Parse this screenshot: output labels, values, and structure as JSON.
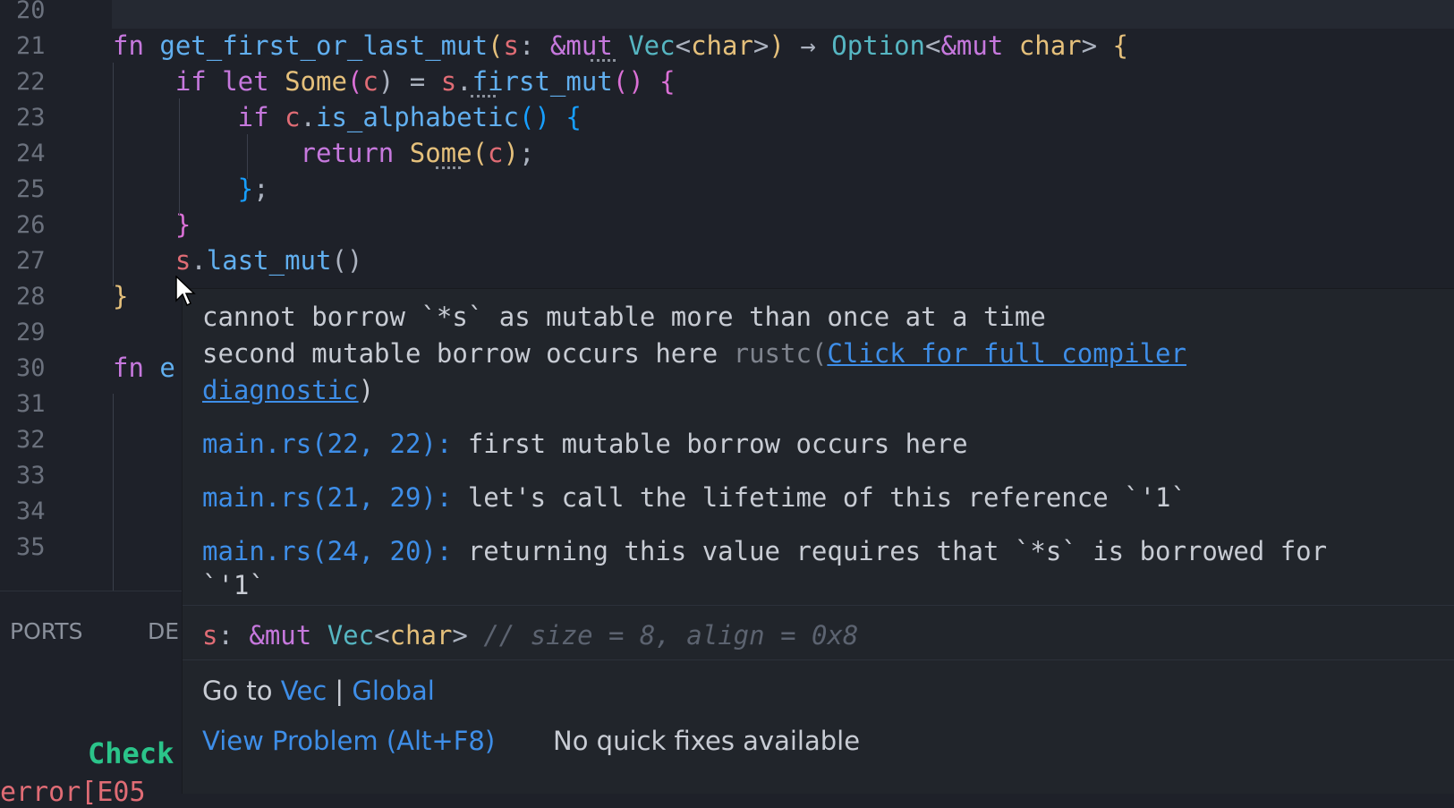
{
  "editor": {
    "lines": [
      {
        "num": "20",
        "tokens": []
      },
      {
        "num": "21",
        "tokens": [
          {
            "t": "fn ",
            "c": "k"
          },
          {
            "t": "get_first_or_last_mut",
            "c": "f"
          },
          {
            "t": "(",
            "c": "b1"
          },
          {
            "t": "s",
            "c": "v"
          },
          {
            "t": ": ",
            "c": "p"
          },
          {
            "t": "&mut ",
            "c": "k"
          },
          {
            "t": "Vec",
            "c": "t"
          },
          {
            "t": "<",
            "c": "p"
          },
          {
            "t": "char",
            "c": "y"
          },
          {
            "t": ">",
            "c": "p"
          },
          {
            "t": ") ",
            "c": "b1"
          },
          {
            "t": "→ ",
            "c": "p"
          },
          {
            "t": "Option",
            "c": "t"
          },
          {
            "t": "<",
            "c": "p"
          },
          {
            "t": "&mut ",
            "c": "k"
          },
          {
            "t": "char",
            "c": "y"
          },
          {
            "t": "> ",
            "c": "p"
          },
          {
            "t": "{",
            "c": "b1"
          }
        ]
      },
      {
        "num": "22",
        "tokens": [
          {
            "t": "    if let ",
            "c": "k"
          },
          {
            "t": "Some",
            "c": "y"
          },
          {
            "t": "(",
            "c": "b2"
          },
          {
            "t": "c",
            "c": "v"
          },
          {
            "t": ") = ",
            "c": "p"
          },
          {
            "t": "s",
            "c": "v"
          },
          {
            "t": ".",
            "c": "p"
          },
          {
            "t": "first_mut",
            "c": "f"
          },
          {
            "t": "() ",
            "c": "b2"
          },
          {
            "t": "{",
            "c": "b2"
          }
        ]
      },
      {
        "num": "23",
        "tokens": [
          {
            "t": "        if ",
            "c": "k"
          },
          {
            "t": "c",
            "c": "v"
          },
          {
            "t": ".",
            "c": "p"
          },
          {
            "t": "is_alphabetic",
            "c": "f"
          },
          {
            "t": "() {",
            "c": "b3"
          }
        ]
      },
      {
        "num": "24",
        "tokens": [
          {
            "t": "            return ",
            "c": "k"
          },
          {
            "t": "Some",
            "c": "y"
          },
          {
            "t": "(",
            "c": "b1"
          },
          {
            "t": "c",
            "c": "v"
          },
          {
            "t": ")",
            "c": "b1"
          },
          {
            "t": ";",
            "c": "p"
          }
        ]
      },
      {
        "num": "25",
        "tokens": [
          {
            "t": "        }",
            "c": "b3"
          },
          {
            "t": ";",
            "c": "p"
          }
        ]
      },
      {
        "num": "26",
        "tokens": [
          {
            "t": "    }",
            "c": "b2"
          }
        ]
      },
      {
        "num": "27",
        "tokens": [
          {
            "t": "    s",
            "c": "v"
          },
          {
            "t": ".",
            "c": "p"
          },
          {
            "t": "last_mut",
            "c": "f"
          },
          {
            "t": "()",
            "c": "p"
          }
        ]
      },
      {
        "num": "28",
        "tokens": [
          {
            "t": "}",
            "c": "b1"
          }
        ]
      },
      {
        "num": "29",
        "tokens": []
      },
      {
        "num": "30",
        "tokens": [
          {
            "t": "fn ",
            "c": "k"
          },
          {
            "t": "e",
            "c": "f"
          }
        ]
      },
      {
        "num": "31",
        "tokens": []
      },
      {
        "num": "32",
        "tokens": []
      },
      {
        "num": "33",
        "tokens": []
      },
      {
        "num": "34",
        "tokens": []
      },
      {
        "num": "35",
        "tokens": []
      }
    ]
  },
  "panel": {
    "tabs": [
      "PORTS",
      "DE"
    ],
    "terminal_line1": "Check",
    "terminal_line2": "error[E05"
  },
  "hover": {
    "message_line1": "cannot borrow `*s` as mutable more than once at a time",
    "message_line2_prefix": "second mutable borrow occurs here ",
    "source": "rustc(",
    "link_part1": "Click for full compiler",
    "link_part2": "diagnostic",
    "close_paren": ")",
    "related": [
      {
        "loc": "main.rs(22, 22):",
        "text": " first mutable borrow occurs here"
      },
      {
        "loc": "main.rs(21, 29):",
        "text": " let's call the lifetime of this reference `'1`"
      },
      {
        "loc": "main.rs(24, 20):",
        "text": " returning this value requires that `*s` is borrowed for"
      }
    ],
    "related_cont": "`'1`",
    "signature": {
      "name": "s",
      "colon": ": ",
      "mut": "&mut ",
      "type": "Vec",
      "lt": "<",
      "inner": "char",
      "gt": ">",
      "comment": " // size = 8, align = 0x8"
    },
    "goto_label": "Go to ",
    "goto_vec": "Vec",
    "goto_sep": " | ",
    "goto_global": "Global",
    "action_view": "View Problem (Alt+F8)",
    "action_fix": "No quick fixes available"
  }
}
